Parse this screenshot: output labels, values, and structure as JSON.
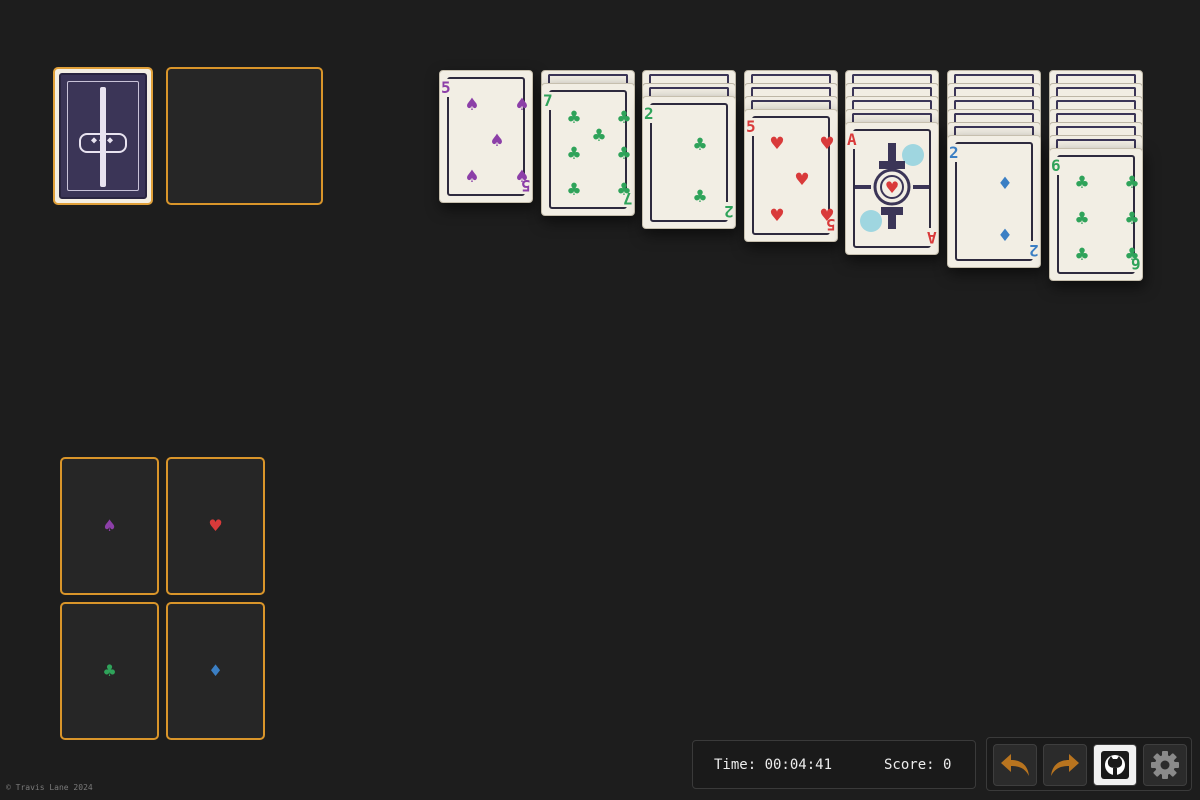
{
  "colors": {
    "background": "#1d1d1d",
    "slot_border": "#d9952a",
    "spade": "#8c3fa8",
    "heart": "#d93a3a",
    "club": "#2fa35a",
    "diamond": "#3b7fc4",
    "card_back": "#3b3557",
    "icon_orange": "#b8741f"
  },
  "foundations": [
    {
      "suit": "spade",
      "glyph": "♠"
    },
    {
      "suit": "heart",
      "glyph": "♥"
    },
    {
      "suit": "club",
      "glyph": "♣"
    },
    {
      "suit": "diamond",
      "glyph": "♦"
    }
  ],
  "tableau": [
    {
      "face_down": 0,
      "card": {
        "rank": "5",
        "suit": "♠",
        "color": "c-purple"
      }
    },
    {
      "face_down": 1,
      "card": {
        "rank": "7",
        "suit": "♣",
        "color": "c-green"
      }
    },
    {
      "face_down": 2,
      "card": {
        "rank": "2",
        "suit": "♣",
        "color": "c-green"
      }
    },
    {
      "face_down": 3,
      "card": {
        "rank": "5",
        "suit": "♥",
        "color": "c-red"
      }
    },
    {
      "face_down": 4,
      "card": {
        "rank": "A",
        "suit": "♥",
        "color": "c-red"
      }
    },
    {
      "face_down": 5,
      "card": {
        "rank": "2",
        "suit": "♦",
        "color": "c-blue"
      }
    },
    {
      "face_down": 6,
      "card": {
        "rank": "6",
        "suit": "♣",
        "color": "c-green"
      }
    }
  ],
  "hud": {
    "time": "Time: 00:04:41",
    "score": "Score: 0"
  },
  "toolbar": {
    "buttons": [
      {
        "icon": "undo-icon"
      },
      {
        "icon": "redo-icon"
      },
      {
        "icon": "github-icon"
      },
      {
        "icon": "gear-icon"
      }
    ]
  },
  "footer": {
    "credit": "© Travis Lane 2024"
  }
}
